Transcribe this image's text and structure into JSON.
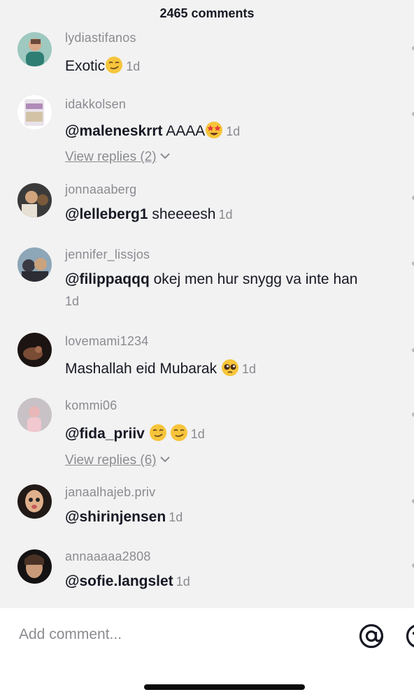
{
  "header": {
    "title": "2465 comments"
  },
  "comments": [
    {
      "username": "lydiastifanos",
      "mention": "",
      "text": "Exotic",
      "emojis": [
        "smirk-emoji"
      ],
      "time": "1d",
      "replies": ""
    },
    {
      "username": "idakkolsen",
      "mention": "@maleneskrrt",
      "text": " AAAA",
      "emojis": [
        "star-struck-emoji"
      ],
      "time": "1d",
      "replies": "View replies (2)"
    },
    {
      "username": "jonnaaaberg",
      "mention": "@lelleberg1",
      "text": " sheeeesh",
      "emojis": [],
      "time": "1d",
      "replies": ""
    },
    {
      "username": "jennifer_lissjos",
      "mention": "@filippaqqq",
      "text": " okej men hur snygg va inte han",
      "emojis": [],
      "time": "1d",
      "replies": ""
    },
    {
      "username": "lovemami1234",
      "mention": "",
      "text": "Mashallah eid Mubarak ",
      "emojis": [
        "pleading-face-emoji"
      ],
      "time": "1d",
      "replies": ""
    },
    {
      "username": "kommi06",
      "mention": "@fida_priiv",
      "text": " ",
      "emojis": [
        "smirk-emoji",
        "smirk-emoji"
      ],
      "time": "1d",
      "replies": "View replies (6)"
    },
    {
      "username": "janaalhajeb.priv",
      "mention": "@shirinjensen",
      "text": "",
      "emojis": [],
      "time": "1d",
      "replies": ""
    },
    {
      "username": "annaaaaa2808",
      "mention": "@sofie.langslet",
      "text": "",
      "emojis": [],
      "time": "1d",
      "replies": ""
    }
  ],
  "composer": {
    "placeholder": "Add comment...",
    "mention_icon": "at-icon",
    "emoji_icon": "emoji-icon"
  },
  "colors": {
    "primary_text": "#161823",
    "secondary_text": "#8a8b91",
    "background": "#f2f2f2"
  }
}
